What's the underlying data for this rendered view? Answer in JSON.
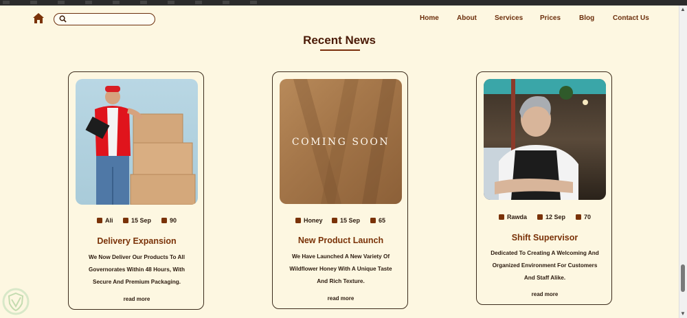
{
  "nav": {
    "search_placeholder": "",
    "menu": [
      "Home",
      "About",
      "Services",
      "Prices",
      "Blog",
      "Contact Us"
    ]
  },
  "section": {
    "title": "Recent News"
  },
  "cards": [
    {
      "image_text": "",
      "author": "Ali",
      "date": "15 Sep",
      "count": "90",
      "title": "Delivery Expansion",
      "body": "We Now Deliver Our Products To All Governorates Within 48 Hours, With Secure And Premium Packaging.",
      "link": "read more"
    },
    {
      "image_text": "COMING SOON",
      "author": "Honey",
      "date": "15 Sep",
      "count": "65",
      "title": "New Product Launch",
      "body": "We Have Launched A New Variety Of Wildflower Honey With A Unique Taste And Rich Texture.",
      "link": "read more"
    },
    {
      "image_text": "",
      "author": "Rawda",
      "date": "12 Sep",
      "count": "70",
      "title": "Shift Supervisor",
      "body": "Dedicated To Creating A Welcoming And Organized Environment For Customers And Staff Alike.",
      "link": "read more"
    }
  ],
  "colors": {
    "brand": "#6b2e0b",
    "background": "#fdf7e1",
    "heading": "#7a3208"
  },
  "icons": {
    "home": "home-icon",
    "search": "search-icon",
    "facebook": "facebook-icon",
    "calendar": "calendar-icon",
    "twitter": "twitter-icon"
  }
}
